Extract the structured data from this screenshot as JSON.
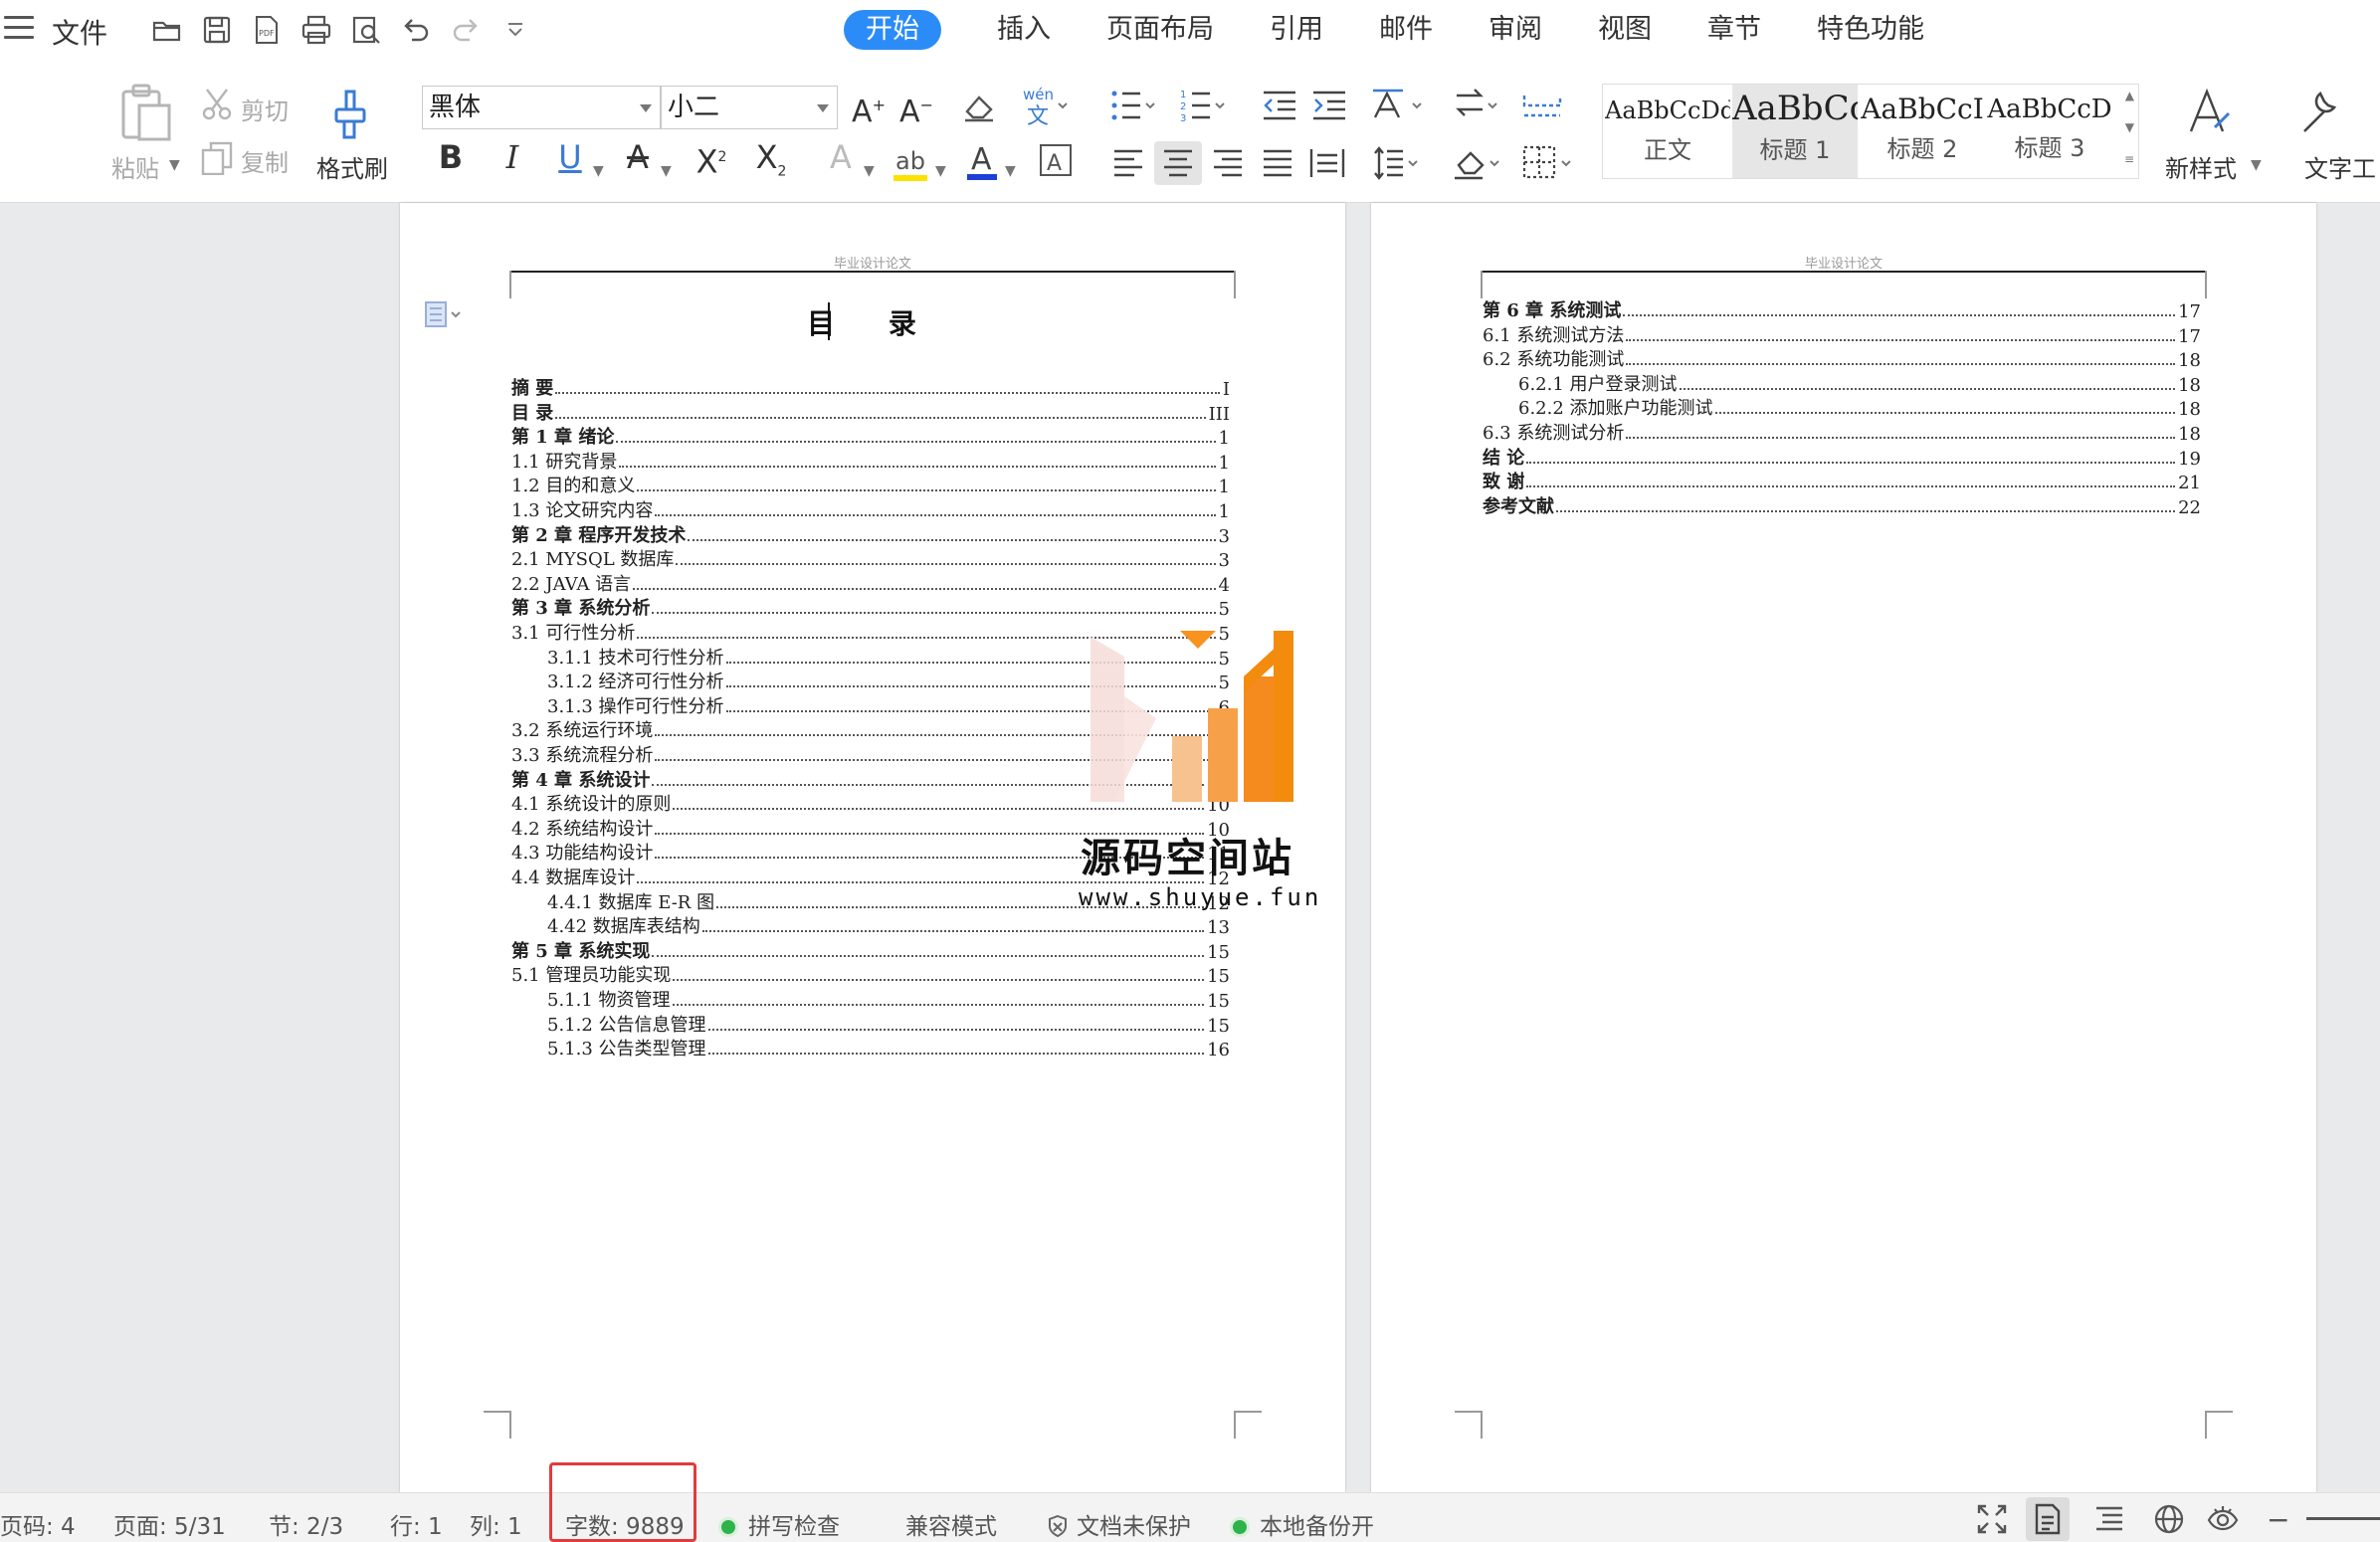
{
  "menubar": {
    "file_label": "文件",
    "tabs": [
      "开始",
      "插入",
      "页面布局",
      "引用",
      "邮件",
      "审阅",
      "视图",
      "章节",
      "特色功能"
    ],
    "active_tab": "开始"
  },
  "ribbon": {
    "paste_label": "粘贴",
    "cut_label": "剪切",
    "copy_label": "复制",
    "format_painter_label": "格式刷",
    "font_name": "黑体",
    "font_size": "小二",
    "styles": [
      {
        "sample": "AaBbCcDd",
        "name": "正文"
      },
      {
        "sample": "AaBbCc",
        "name": "标题 1"
      },
      {
        "sample": "AaBbCcI",
        "name": "标题 2"
      },
      {
        "sample": "AaBbCcD",
        "name": "标题 3"
      }
    ],
    "new_style_label": "新样式",
    "text_tools_label": "文字工"
  },
  "document": {
    "header_text": "毕业设计论文",
    "toc_title": "目  录",
    "page1_entries": [
      {
        "text": "摘    要",
        "page": "I",
        "bold": true,
        "indent": 0
      },
      {
        "text": "目    录",
        "page": "III",
        "bold": true,
        "indent": 0
      },
      {
        "text": "第 1 章  绪论",
        "page": "1",
        "bold": true,
        "indent": 0
      },
      {
        "text": "1.1  研究背景",
        "page": "1",
        "bold": false,
        "indent": 0
      },
      {
        "text": "1.2 目的和意义",
        "page": "1",
        "bold": false,
        "indent": 0
      },
      {
        "text": "1.3  论文研究内容",
        "page": "1",
        "bold": false,
        "indent": 0
      },
      {
        "text": "第 2 章  程序开发技术",
        "page": "3",
        "bold": true,
        "indent": 0
      },
      {
        "text": "2.1 MYSQL 数据库",
        "page": "3",
        "bold": false,
        "indent": 0
      },
      {
        "text": "2.2 JAVA 语言",
        "page": "4",
        "bold": false,
        "indent": 0
      },
      {
        "text": "第 3 章  系统分析",
        "page": "5",
        "bold": true,
        "indent": 0
      },
      {
        "text": "3.1 可行性分析",
        "page": "5",
        "bold": false,
        "indent": 0
      },
      {
        "text": "3.1.1 技术可行性分析",
        "page": "5",
        "bold": false,
        "indent": 1
      },
      {
        "text": "3.1.2 经济可行性分析",
        "page": "5",
        "bold": false,
        "indent": 1
      },
      {
        "text": "3.1.3 操作可行性分析",
        "page": "6",
        "bold": false,
        "indent": 1
      },
      {
        "text": "3.2 系统运行环境",
        "page": "6",
        "bold": false,
        "indent": 0
      },
      {
        "text": "3.3 系统流程分析",
        "page": "6",
        "bold": false,
        "indent": 0
      },
      {
        "text": "第 4 章  系统设计",
        "page": "10",
        "bold": true,
        "indent": 0
      },
      {
        "text": "4.1  系统设计的原则",
        "page": "10",
        "bold": false,
        "indent": 0
      },
      {
        "text": "4.2  系统结构设计",
        "page": "10",
        "bold": false,
        "indent": 0
      },
      {
        "text": "4.3 功能结构设计",
        "page": "11",
        "bold": false,
        "indent": 0
      },
      {
        "text": "4.4 数据库设计",
        "page": "12",
        "bold": false,
        "indent": 0
      },
      {
        "text": "4.4.1  数据库 E-R 图",
        "page": "12",
        "bold": false,
        "indent": 1
      },
      {
        "text": "4.42  数据库表结构",
        "page": "13",
        "bold": false,
        "indent": 1
      },
      {
        "text": "第 5 章  系统实现",
        "page": "15",
        "bold": true,
        "indent": 0
      },
      {
        "text": "5.1 管理员功能实现",
        "page": "15",
        "bold": false,
        "indent": 0
      },
      {
        "text": "5.1.1  物资管理",
        "page": "15",
        "bold": false,
        "indent": 1
      },
      {
        "text": "5.1.2  公告信息管理",
        "page": "15",
        "bold": false,
        "indent": 1
      },
      {
        "text": "5.1.3 公告类型管理",
        "page": "16",
        "bold": false,
        "indent": 1
      }
    ],
    "page2_entries": [
      {
        "text": "第 6 章  系统测试",
        "page": "17",
        "bold": true,
        "indent": 0
      },
      {
        "text": "6.1 系统测试方法",
        "page": "17",
        "bold": false,
        "indent": 0
      },
      {
        "text": "6.2  系统功能测试",
        "page": "18",
        "bold": false,
        "indent": 0
      },
      {
        "text": "6.2.1  用户登录测试",
        "page": "18",
        "bold": false,
        "indent": 1
      },
      {
        "text": "6.2.2  添加账户功能测试",
        "page": "18",
        "bold": false,
        "indent": 1
      },
      {
        "text": "6.3  系统测试分析",
        "page": "18",
        "bold": false,
        "indent": 0
      },
      {
        "text": "结    论",
        "page": "19",
        "bold": true,
        "indent": 0
      },
      {
        "text": "致    谢",
        "page": "21",
        "bold": true,
        "indent": 0
      },
      {
        "text": "参考文献",
        "page": "22",
        "bold": true,
        "indent": 0
      }
    ]
  },
  "watermark": {
    "title": "源码空间站",
    "url": "www.shuyue.fun"
  },
  "statusbar": {
    "page_no": "页码: 4",
    "page": "页面: 5/31",
    "section": "节: 2/3",
    "row": "行: 1",
    "col": "列: 1",
    "word_count": "字数: 9889",
    "spell_check": "拼写检查",
    "compat_mode": "兼容模式",
    "doc_protect": "文档未保护",
    "backup": "本地备份开"
  },
  "colors": {
    "accent": "#2b8cf7",
    "highlight_box": "#e23b3b",
    "status_ok": "#2eb34a",
    "watermark_orange": "#f7931e"
  }
}
